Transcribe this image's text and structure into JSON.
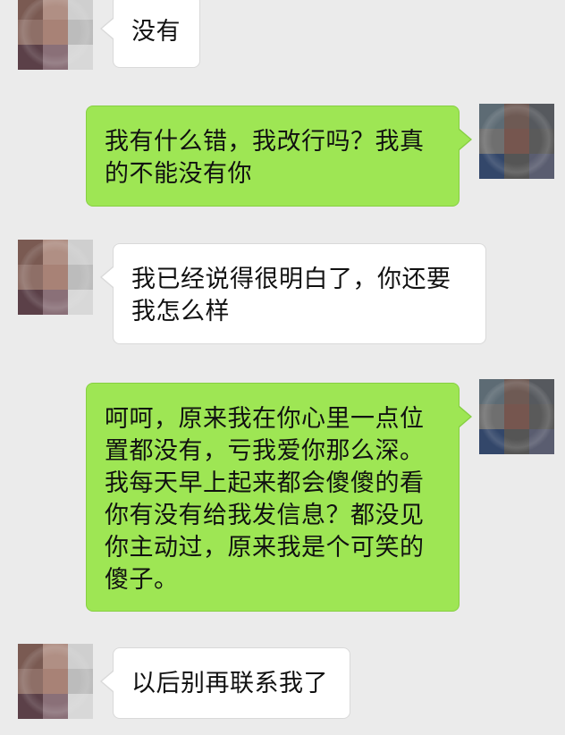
{
  "messages": [
    {
      "side": "in",
      "text": "没有"
    },
    {
      "side": "out",
      "text": "我有什么错，我改行吗？我真的不能没有你"
    },
    {
      "side": "in",
      "text": "我已经说得很明白了，你还要我怎么样"
    },
    {
      "side": "out",
      "text": "呵呵，原来我在你心里一点位置都没有，亏我爱你那么深。我每天早上起来都会傻傻的看你有没有给我发信息？都没见你主动过，原来我是个可笑的傻子。"
    },
    {
      "side": "in",
      "text": "以后别再联系我了"
    }
  ],
  "colors": {
    "background": "#ebebeb",
    "incoming_bubble": "#ffffff",
    "outgoing_bubble": "#9ee654",
    "text": "#111111"
  },
  "icons": {
    "contact_avatar": "pixelated-avatar-icon",
    "self_avatar": "pixelated-avatar-icon"
  }
}
